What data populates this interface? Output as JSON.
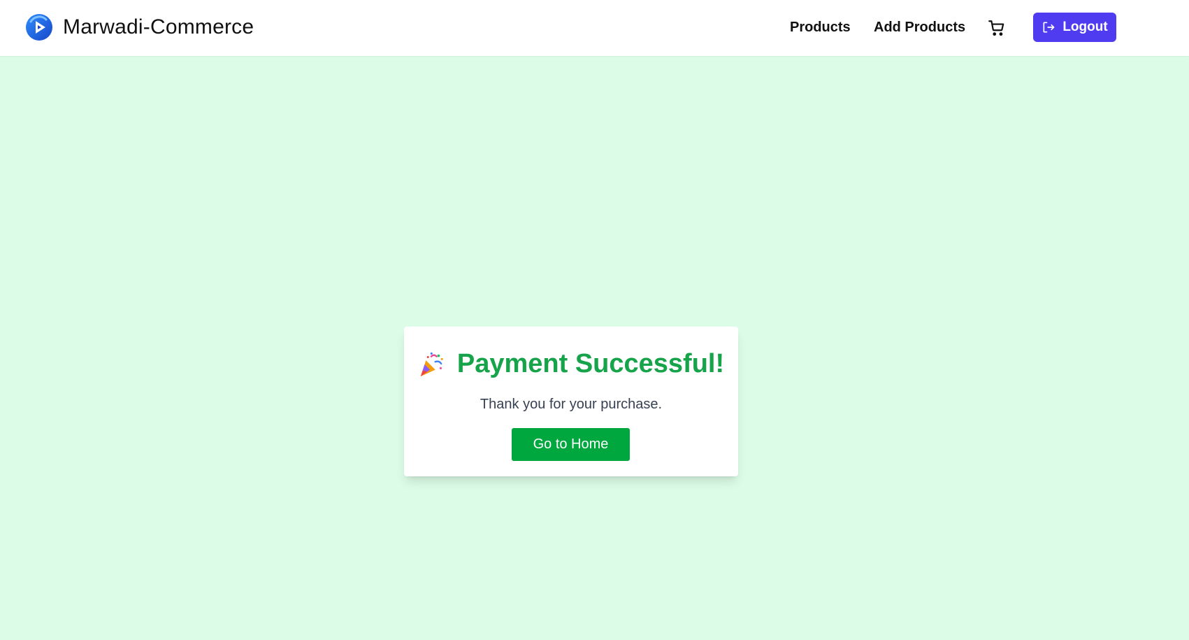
{
  "navbar": {
    "brand_name": "Marwadi-Commerce",
    "brand_logo_icon": "play-circle-logo-icon",
    "links": [
      {
        "label": "Products"
      },
      {
        "label": "Add Products"
      }
    ],
    "cart_icon": "shopping-cart-icon",
    "logout": {
      "label": "Logout",
      "icon": "logout-arrow-icon"
    }
  },
  "card": {
    "icon": "party-popper-icon",
    "title": "Payment Successful!",
    "message": "Thank you for your purchase.",
    "button_label": "Go to Home"
  },
  "colors": {
    "page_background": "#dcfce7",
    "accent_green": "#16a34a",
    "button_green": "#00a63e",
    "logout_purple": "#4f3bf0",
    "brand_blue": "#1d6ff2"
  }
}
